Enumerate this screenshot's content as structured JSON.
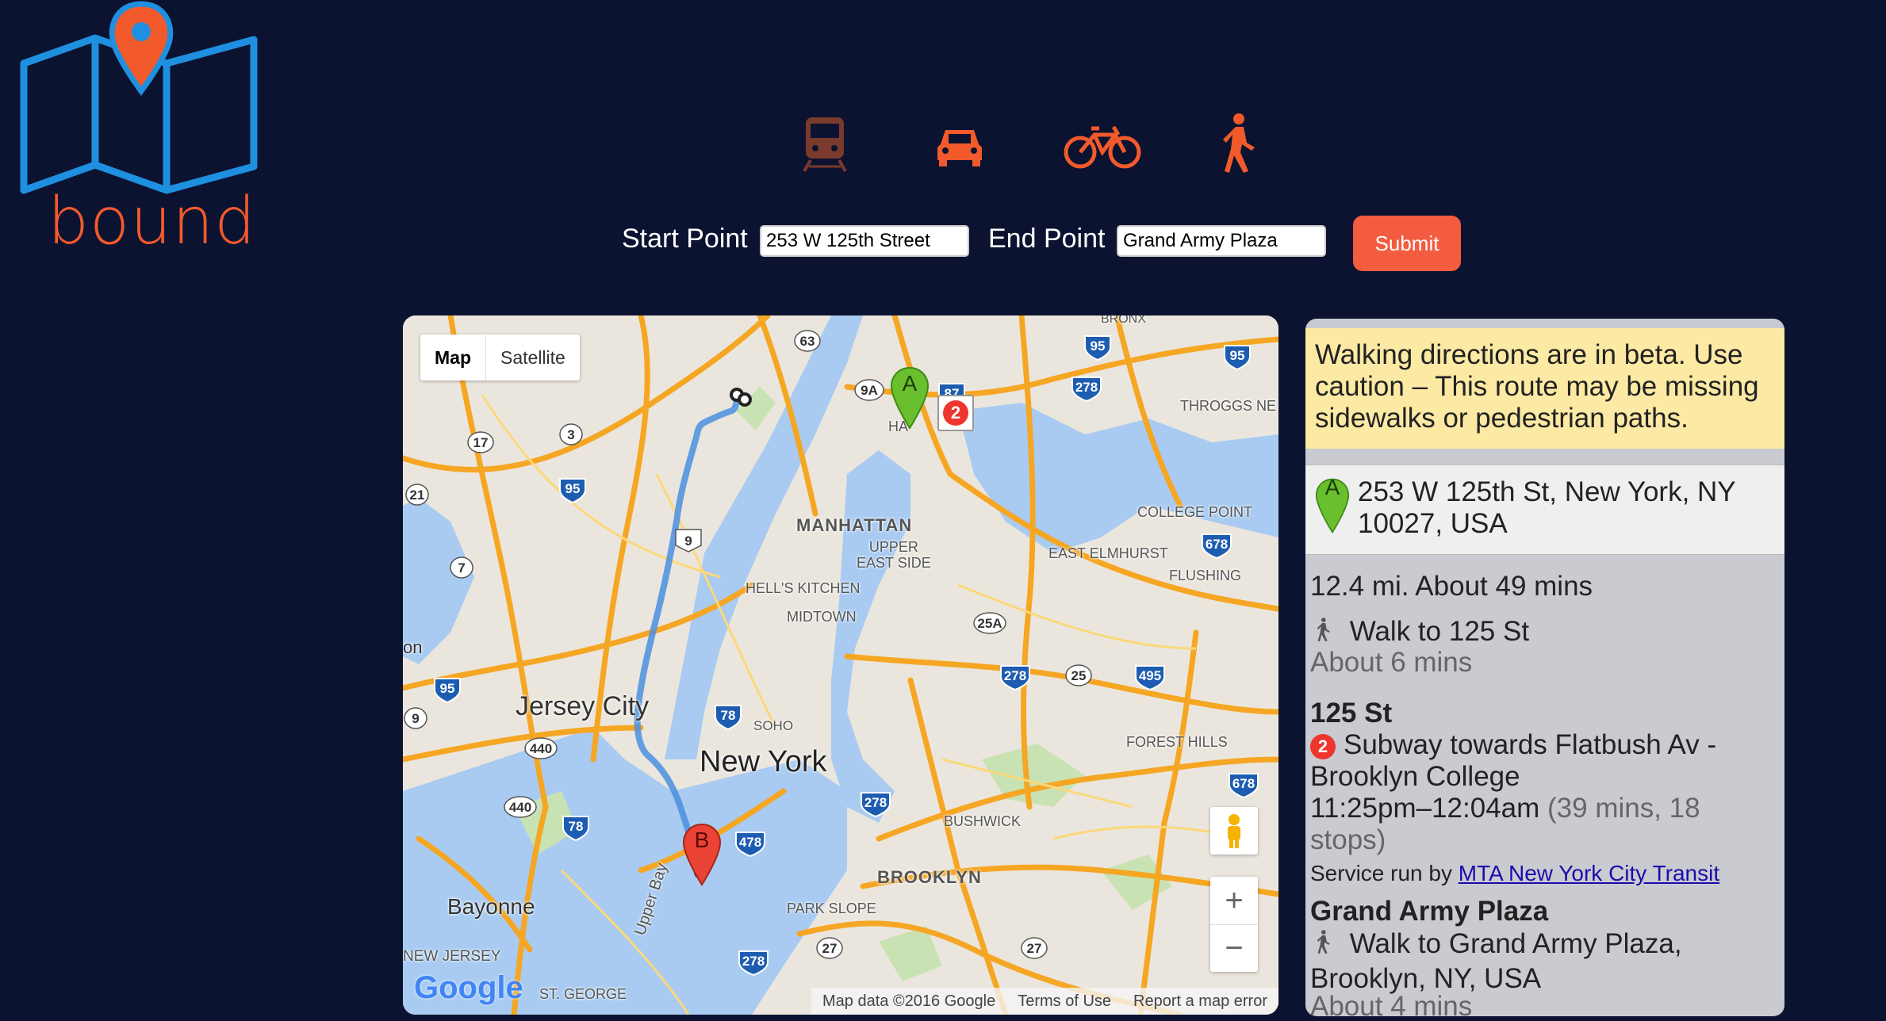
{
  "app": {
    "logo_text": "bound"
  },
  "modes": [
    {
      "name": "transit",
      "icon": "train-icon",
      "active": false
    },
    {
      "name": "driving",
      "icon": "car-icon",
      "active": false
    },
    {
      "name": "bicycling",
      "icon": "bicycle-icon",
      "active": false
    },
    {
      "name": "walking",
      "icon": "walking-icon",
      "active": true
    }
  ],
  "form": {
    "start_label": "Start Point",
    "start_value": "253 W 125th Street",
    "end_label": "End Point",
    "end_value": "Grand Army Plaza",
    "submit_label": "Submit"
  },
  "map": {
    "type_map": "Map",
    "type_satellite": "Satellite",
    "labels": {
      "manhattan": "MANHATTAN",
      "upper_east_side": "UPPER\nEAST SIDE",
      "hells_kitchen": "HELL'S KITCHEN",
      "midtown": "MIDTOWN",
      "jersey_city": "Jersey City",
      "new_york": "New York",
      "soho": "SOHO",
      "brooklyn": "BROOKLYN",
      "park_slope": "PARK SLOPE",
      "bushwick": "BUSHWICK",
      "bayonne": "Bayonne",
      "new_jersey": "NEW JERSEY",
      "east_elmhurst": "EAST ELMHURST",
      "college_point": "COLLEGE POINT",
      "flushing": "FLUSHING",
      "forest_hills": "FOREST HILLS",
      "throggs_neck": "THROGGS NE",
      "bronx": "BRONX",
      "st_george": "ST. GEORGE",
      "upper_bay": "Upper Bay",
      "on": "on",
      "harlem": "HA"
    },
    "marker_a": "A",
    "marker_b": "B",
    "line_badge": "2",
    "zoom_in": "+",
    "zoom_out": "−",
    "google_logo": "Google",
    "footer": {
      "map_data": "Map data ©2016 Google",
      "terms": "Terms of Use",
      "report": "Report a map error"
    },
    "shields": [
      "63",
      "95",
      "95",
      "87",
      "278",
      "9A",
      "17",
      "3",
      "95",
      "21",
      "9",
      "7",
      "678",
      "25A",
      "278",
      "25",
      "495",
      "78",
      "440",
      "440",
      "78",
      "278",
      "478",
      "678",
      "27",
      "27",
      "9",
      "95",
      "278"
    ],
    "colors": {
      "route": "#4a8fe0",
      "highway": "#f5a623",
      "water": "#a9cbf1",
      "land": "#e9e5dc",
      "park": "#c9e2b3"
    }
  },
  "directions": {
    "warning": "Walking directions are in beta. Use caution – This route may be missing sidewalks or pedestrian paths.",
    "start_marker": "A",
    "start_address": "253 W 125th St, New York, NY 10027, USA",
    "summary": "12.4 mi. About 49 mins",
    "step1_text": "Walk to 125 St",
    "step1_time": "About 6 mins",
    "stop1_name": "125 St",
    "line_badge": "2",
    "subway_text": "Subway towards Flatbush Av - Brooklyn College",
    "subway_time": "11:25pm–12:04am",
    "subway_detail": "(39 mins, 18 stops)",
    "service_prefix": "Service run by",
    "service_link": "MTA New York City Transit",
    "stop2_name": "Grand Army Plaza",
    "step3_text": "Walk to Grand Army Plaza, Brooklyn, NY, USA",
    "step3_time": "About 4 mins"
  }
}
